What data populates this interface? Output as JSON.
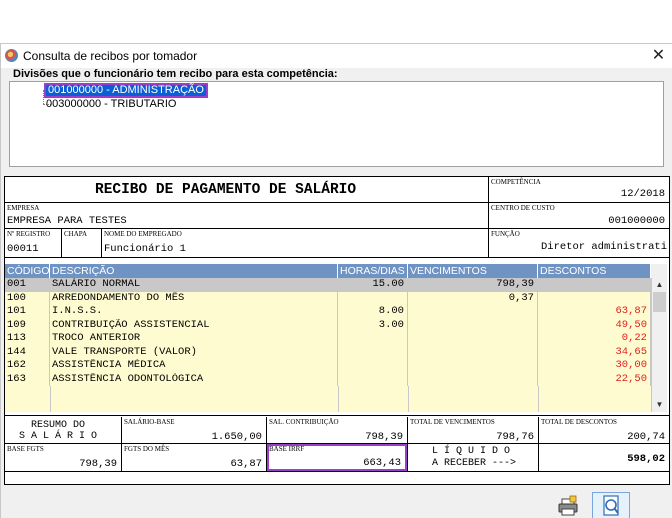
{
  "window": {
    "title": "Consulta de recibos por tomador",
    "close_glyph": "✕",
    "icon": "app-globe-icon"
  },
  "divisions": {
    "label": "Divisões que o funcionário tem recibo para esta competência:",
    "items": [
      {
        "label": "001000000 - ADMINISTRAÇÃO",
        "selected": true
      },
      {
        "label": "003000000 - TRIBUTARIO",
        "selected": false
      }
    ]
  },
  "receipt": {
    "title": "RECIBO DE PAGAMENTO DE SALÁRIO",
    "competencia_label": "COMPETÊNCIA",
    "competencia": "12/2018",
    "empresa_label": "EMPRESA",
    "empresa": "EMPRESA PARA TESTES",
    "centro_custo_label": "CENTRO DE CUSTO",
    "centro_custo": "001000000",
    "registro_label": "Nº REGISTRO",
    "registro": "00011",
    "chapa_label": "CHAPA",
    "chapa": "",
    "nome_label": "NOME DO EMPREGADO",
    "nome": "Funcionário 1",
    "funcao_label": "FUNÇÃO",
    "funcao": "Diretor administrati"
  },
  "grid": {
    "headers": [
      "CÓDIGO",
      "DESCRIÇÃO",
      "HORAS/DIAS",
      "VENCIMENTOS",
      "DESCONTOS"
    ],
    "rows": [
      {
        "codigo": "001",
        "descricao": "SALÁRIO NORMAL",
        "horas": "15.00",
        "venc": "798,39",
        "desc": ""
      },
      {
        "codigo": "100",
        "descricao": "ARREDONDAMENTO DO MÊS",
        "horas": "",
        "venc": "0,37",
        "desc": ""
      },
      {
        "codigo": "101",
        "descricao": "I.N.S.S.",
        "horas": "8.00",
        "venc": "",
        "desc": "63,87"
      },
      {
        "codigo": "109",
        "descricao": "CONTRIBUIÇÃO ASSISTENCIAL",
        "horas": "3.00",
        "venc": "",
        "desc": "49,50"
      },
      {
        "codigo": "113",
        "descricao": "TROCO ANTERIOR",
        "horas": "",
        "venc": "",
        "desc": "0,22"
      },
      {
        "codigo": "144",
        "descricao": "VALE TRANSPORTE (VALOR)",
        "horas": "",
        "venc": "",
        "desc": "34,65"
      },
      {
        "codigo": "162",
        "descricao": "ASSISTÊNCIA MÉDICA",
        "horas": "",
        "venc": "",
        "desc": "30,00"
      },
      {
        "codigo": "163",
        "descricao": "ASSISTÊNCIA ODONTOLÓGICA",
        "horas": "",
        "venc": "",
        "desc": "22,50"
      }
    ],
    "scroll_up": "▲",
    "scroll_down": "▼"
  },
  "summary": {
    "resumo_line1": "RESUMO DO",
    "resumo_line2": "S A L Á R I O",
    "salario_base_label": "SALÁRIO-BASE",
    "salario_base": "1.650,00",
    "sal_contrib_label": "SAL. CONTRIBUIÇÃO",
    "sal_contrib": "798,39",
    "total_venc_label": "TOTAL DE VENCIMENTOS",
    "total_venc": "798,76",
    "total_desc_label": "TOTAL DE DESCONTOS",
    "total_desc": "200,74",
    "base_fgts_label": "BASE FGTS",
    "base_fgts": "798,39",
    "fgts_mes_label": "FGTS DO MÊS",
    "fgts_mes": "63,87",
    "base_irrf_label": "BASE IRRF",
    "base_irrf": "663,43",
    "liquido_line1": "L Í Q U I D O",
    "liquido_line2": "A RECEBER --->",
    "liquido": "598,02"
  },
  "buttons": {
    "print_icon": "print-icon",
    "view_icon": "search-document-icon"
  },
  "colors": {
    "grid_header": "#6f93c2",
    "selected_row": "#c8c8c8",
    "row_yellow": "#fffbd0",
    "discount_red": "#e02020",
    "highlight_border": "#9b3fc9",
    "selection_blue": "#0a5fd6"
  }
}
